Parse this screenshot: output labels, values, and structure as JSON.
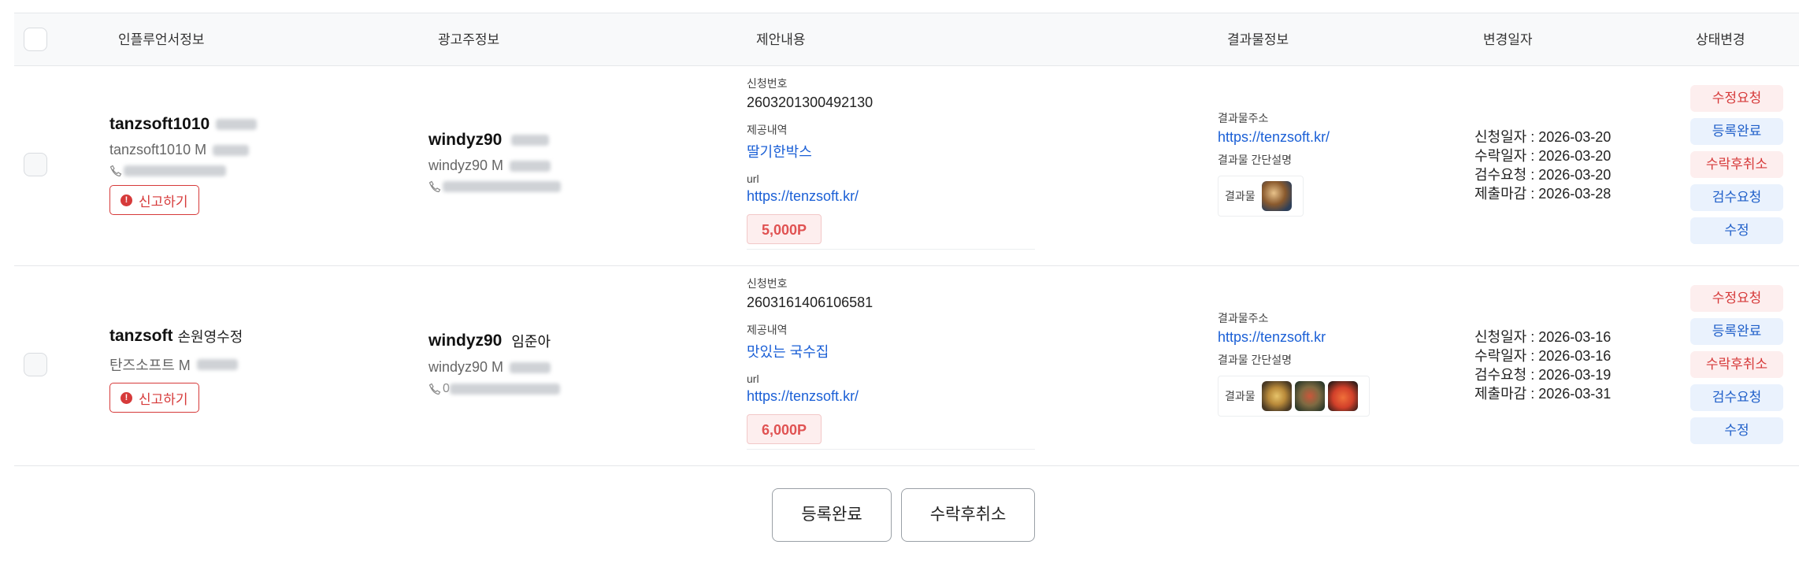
{
  "headers": {
    "influencer": "인플루언서정보",
    "advertiser": "광고주정보",
    "proposal": "제안내용",
    "result": "결과물정보",
    "date": "변경일자",
    "status": "상태변경"
  },
  "labels": {
    "report": "신고하기",
    "apply_no": "신청번호",
    "provided": "제공내역",
    "url": "url",
    "result_addr": "결과물주소",
    "result_desc": "결과물 간단설명",
    "result_thumb": "결과물",
    "phone_prefix_2": "0"
  },
  "rows": [
    {
      "inf_id": "tanzsoft1010",
      "inf_extra": "",
      "inf_sub": "tanzsoft1010 M",
      "adv_id": "windyz90",
      "adv_extra": "",
      "adv_sub": "windyz90 M",
      "apply_no": "2603201300492130",
      "provided": "딸기한박스",
      "url": "https://tenzsoft.kr/",
      "point": "5,000P",
      "result_url": "https://tenzsoft.kr/",
      "dates": [
        "신청일자 : 2026-03-20",
        "수락일자 : 2026-03-20",
        "검수요청 : 2026-03-20",
        "제출마감 : 2026-03-28"
      ]
    },
    {
      "inf_id": "tanzsoft",
      "inf_extra": "손원영수정",
      "inf_sub": "탄즈소프트 M",
      "adv_id": "windyz90",
      "adv_extra": "임준아",
      "adv_sub": "windyz90 M",
      "apply_no": "2603161406106581",
      "provided": "맛있는 국수집",
      "url": "https://tenzsoft.kr/",
      "point": "6,000P",
      "result_url": "https://tenzsoft.kr",
      "dates": [
        "신청일자 : 2026-03-16",
        "수락일자 : 2026-03-16",
        "검수요청 : 2026-03-19",
        "제출마감 : 2026-03-31"
      ]
    }
  ],
  "status_buttons": [
    "수정요청",
    "등록완료",
    "수락후취소",
    "검수요청",
    "수정"
  ],
  "footer": {
    "register_done": "등록완료",
    "cancel_after_accept": "수락후취소"
  },
  "colors": {
    "danger": "#d63a3a",
    "primary": "#1f5fc9",
    "link": "#1a5fd6",
    "point_bg": "#fdeeee"
  },
  "icons": [
    "checkbox",
    "phone-icon",
    "alert-icon",
    "result-thumbnail"
  ]
}
